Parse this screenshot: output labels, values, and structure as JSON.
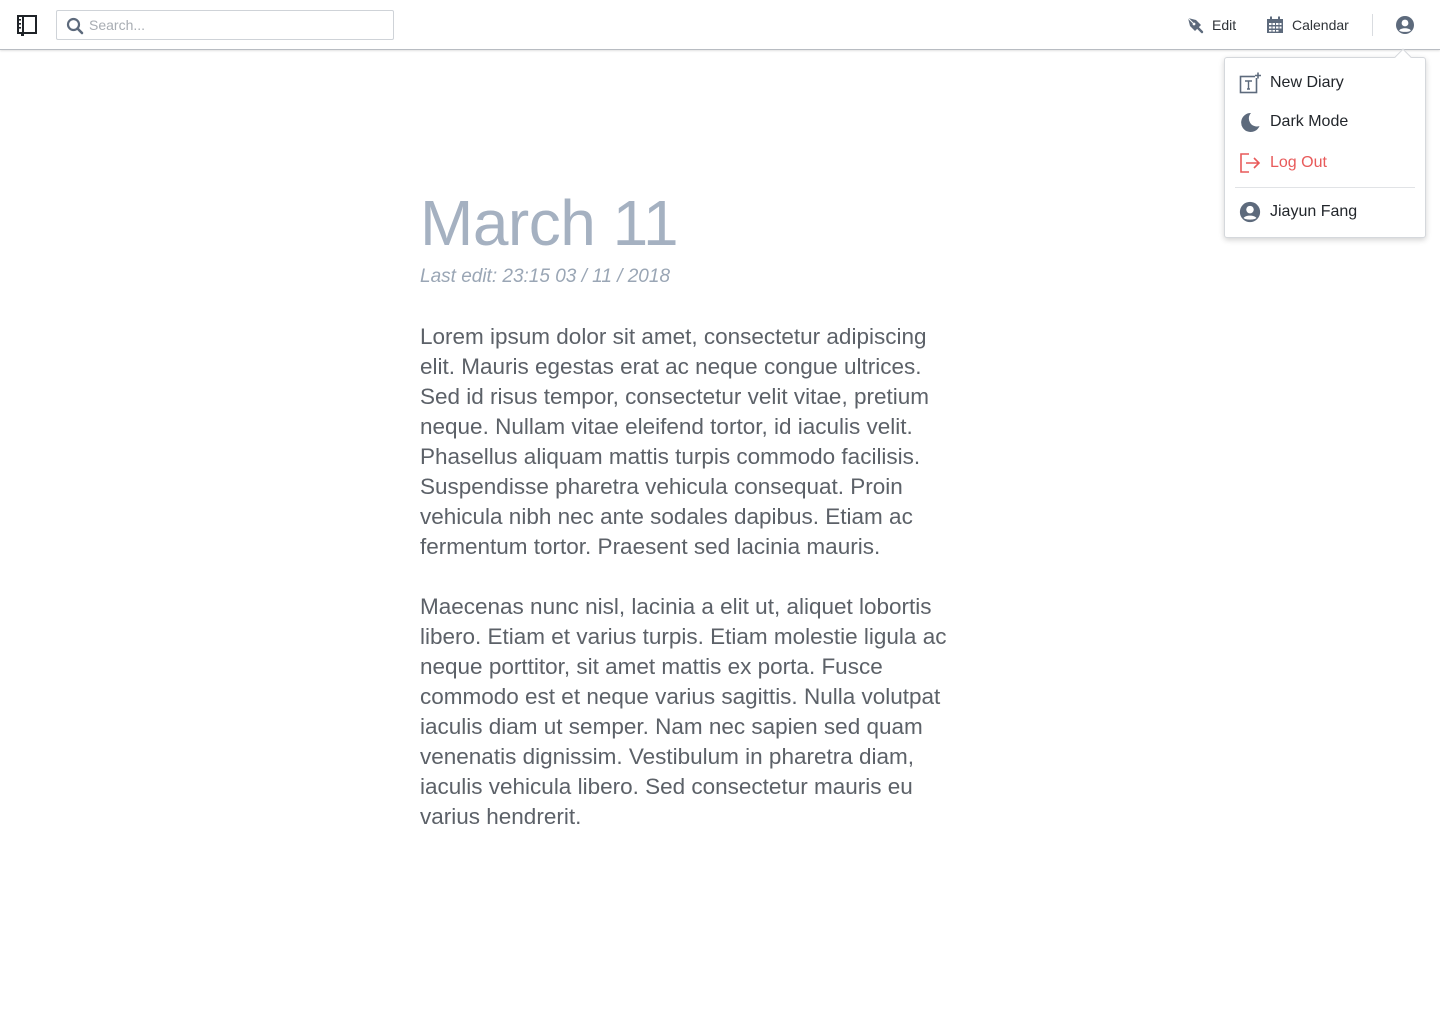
{
  "topbar": {
    "search": {
      "placeholder": "Search...",
      "value": ""
    },
    "nav": {
      "edit_label": "Edit",
      "calendar_label": "Calendar"
    }
  },
  "icons": {
    "logo": "notebook-icon",
    "search": "search-icon",
    "edit": "pen-nib-icon",
    "calendar": "calendar-icon",
    "account": "user-circle-icon",
    "new_diary": "new-document-icon",
    "dark_mode": "moon-icon",
    "log_out": "sign-out-icon",
    "user": "user-circle-icon"
  },
  "user_menu": {
    "new_diary": "New Diary",
    "dark_mode": "Dark Mode",
    "log_out": "Log Out",
    "user_name": "Jiayun Fang"
  },
  "entry": {
    "title": "March 11",
    "last_edit": "Last edit: 23:15 03 / 11 / 2018",
    "paragraphs": [
      "Lorem ipsum dolor sit amet, consectetur adipiscing elit. Mauris egestas erat ac neque congue ultrices. Sed id risus tempor, consectetur velit vitae, pretium neque. Nullam vitae eleifend tortor, id iaculis velit. Phasellus aliquam mattis turpis commodo facilisis. Suspendisse pharetra vehicula consequat. Proin vehicula nibh nec ante sodales dapibus. Etiam ac fermentum tortor. Praesent sed lacinia mauris.",
      "Maecenas nunc nisl, lacinia a elit ut, aliquet lobortis libero. Etiam et varius turpis. Etiam molestie ligula ac neque porttitor, sit amet mattis ex porta. Fusce commodo est et neque varius sagittis. Nulla volutpat iaculis diam ut semper. Nam nec sapien sed quam venenatis dignissim. Vestibulum in pharetra diam, iaculis vehicula libero. Sed consectetur mauris eu varius hendrerit."
    ]
  },
  "colors": {
    "title": "#a5b1c1",
    "body_text": "#5c6168",
    "log_out": "#e85a5a",
    "icon": "#5d6a7c"
  }
}
